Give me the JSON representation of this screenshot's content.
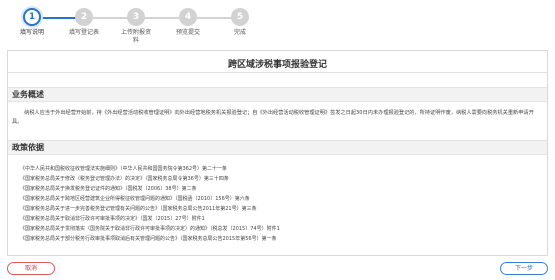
{
  "steps": [
    {
      "num": "1",
      "label": "填写说明"
    },
    {
      "num": "2",
      "label": "填写登记表"
    },
    {
      "num": "3",
      "label": "上传附报资料"
    },
    {
      "num": "4",
      "label": "预览提交"
    },
    {
      "num": "5",
      "label": "完成"
    }
  ],
  "page_title": "跨区域涉税事项报验登记",
  "sections": {
    "summary_title": "业务概述",
    "policy_title": "政策依据"
  },
  "summary_text": "纳税人应当于外出经营开始前，持《外出经营活动税收管理证明》向外出经营地税务机关报验登记；自《外出经营活动税收管理证明》签发之日起30日内未办理报验登记的，所持证明作废，纳税人需要向税务机关重新申请开具。",
  "policies": [
    "《中华人民共和国税收征收管理法实施细则》（中华人民共和国国务院令第362号）第二十一条",
    "《国家税务总局关于修改〈税务登记管理办法〉的决定》（国家税务总局令第36号）第三十四条",
    "《国家税务总局关于换发税务登记证件的通知》（国税发〔2006〕38号）第二条",
    "《国家税务总局关于跨地区经营建筑企业所得税征收管理问题的通知》（国税函〔2010〕156号）第六条",
    "《国家税务总局关于进一步完善税务登记管理有关问题的公告》（国家税务总局公告2011年第21号）第三条",
    "《国家税务总局关于取消非行政许可审批事项的决定》（国发〔2015〕27号）附件1",
    "《国家税务总局关于贯彻落实〈国务院关于取消非行政许可审批事项的决定〉的通知》（税总发〔2015〕74号）附件1",
    "《国家税务总局关于部分税务行政审批事项取消后有关管理问题的公告》（国家税务总局公告2015年第56号）第一条"
  ],
  "buttons": {
    "cancel": "取消",
    "next": "下一步"
  },
  "active_step": 1
}
